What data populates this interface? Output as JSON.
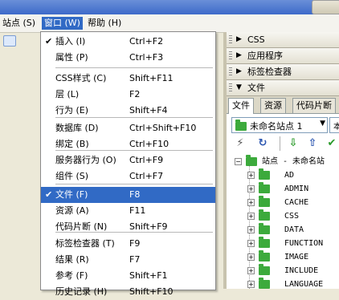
{
  "menubar": {
    "site": "站点 (S)",
    "window": "窗口 (W)",
    "help": "帮助 (H)"
  },
  "window_menu": {
    "items": [
      {
        "label": "插入 (I)",
        "shortcut": "Ctrl+F2",
        "checked": true
      },
      {
        "label": "属性 (P)",
        "shortcut": "Ctrl+F3"
      },
      {
        "label": "CSS样式 (C)",
        "shortcut": "Shift+F11"
      },
      {
        "label": "层 (L)",
        "shortcut": "F2"
      },
      {
        "label": "行为 (E)",
        "shortcut": "Shift+F4"
      },
      {
        "label": "数据库 (D)",
        "shortcut": "Ctrl+Shift+F10"
      },
      {
        "label": "绑定 (B)",
        "shortcut": "Ctrl+F10"
      },
      {
        "label": "服务器行为 (O)",
        "shortcut": "Ctrl+F9"
      },
      {
        "label": "组件 (S)",
        "shortcut": "Ctrl+F7"
      },
      {
        "label": "文件 (F)",
        "shortcut": "F8",
        "checked": true,
        "highlighted": true
      },
      {
        "label": "资源 (A)",
        "shortcut": "F11"
      },
      {
        "label": "代码片断 (N)",
        "shortcut": "Shift+F9"
      },
      {
        "label": "标签检查器 (T)",
        "shortcut": "F9"
      },
      {
        "label": "结果 (R)",
        "shortcut": "F7"
      },
      {
        "label": "参考 (F)",
        "shortcut": "Shift+F1"
      },
      {
        "label": "历史记录 (H)",
        "shortcut": "Shift+F10"
      }
    ],
    "check_glyph": "✔"
  },
  "panels": {
    "groups": [
      {
        "label": "CSS",
        "arrow": "▶"
      },
      {
        "label": "应用程序",
        "arrow": "▶"
      },
      {
        "label": "标签检查器",
        "arrow": "▶"
      },
      {
        "label": "文件",
        "arrow": "▼"
      }
    ],
    "tabs": [
      "文件",
      "资源",
      "代码片断"
    ],
    "site_select": "未命名站点 1",
    "dropdown_arrow": "▼",
    "right_select_glyph": "本",
    "tree": {
      "root": "站点 - 未命名站",
      "folders": [
        "AD",
        "ADMIN",
        "CACHE",
        "CSS",
        "DATA",
        "FUNCTION",
        "IMAGE",
        "INCLUDE",
        "LANGUAGE"
      ],
      "expand_glyph": "+",
      "collapse_glyph": "−"
    }
  },
  "colors": {
    "highlight": "#316ac5",
    "folder": "#3caa3c",
    "refresh": "#2a55b0"
  }
}
